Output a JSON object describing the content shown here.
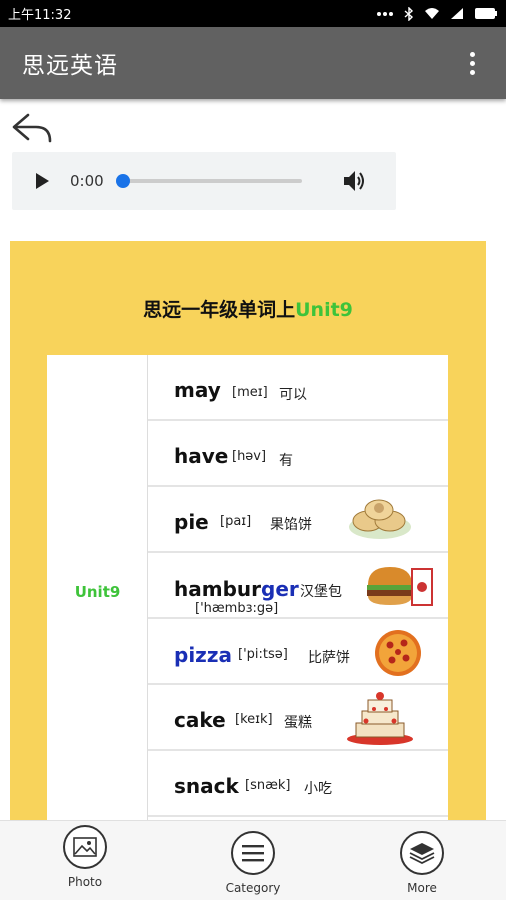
{
  "status_bar": {
    "time": "上午11:32"
  },
  "app_bar": {
    "title": "思远英语"
  },
  "audio": {
    "current_time": "0:00",
    "progress": 0
  },
  "poster": {
    "title_prefix": "思远一年级单词上",
    "title_unit": "Unit9",
    "unit_label": "Unit9",
    "words": [
      {
        "word": "may",
        "phonetic": "[meɪ]",
        "meaning": "可以",
        "image": "none"
      },
      {
        "word": "have",
        "phonetic": "[həv]",
        "meaning": "有",
        "image": "none"
      },
      {
        "word": "pie",
        "phonetic": "[paɪ]",
        "meaning": "果馅饼",
        "image": "pie-icon"
      },
      {
        "word_prefix": "hambur",
        "word_suffix": "ger",
        "phonetic": "['hæmbɜ:gə]",
        "meaning": "汉堡包",
        "image": "hamburger-icon"
      },
      {
        "word": "pizza",
        "phonetic": "['pi:tsə]",
        "meaning": "比萨饼",
        "image": "pizza-icon"
      },
      {
        "word": "cake",
        "phonetic": "[keɪk]",
        "meaning": "蛋糕",
        "image": "cake-icon"
      },
      {
        "word": "snack",
        "phonetic": "[snæk]",
        "meaning": "小吃",
        "image": "none"
      }
    ],
    "colors": {
      "background": "#f8d35b",
      "unit_green": "#3ec33a",
      "highlight_blue": "#1a2fb5"
    }
  },
  "bottom_nav": {
    "items": [
      {
        "label": "Photo",
        "icon": "photo-icon"
      },
      {
        "label": "Category",
        "icon": "menu-icon"
      },
      {
        "label": "More",
        "icon": "layers-icon"
      }
    ]
  }
}
